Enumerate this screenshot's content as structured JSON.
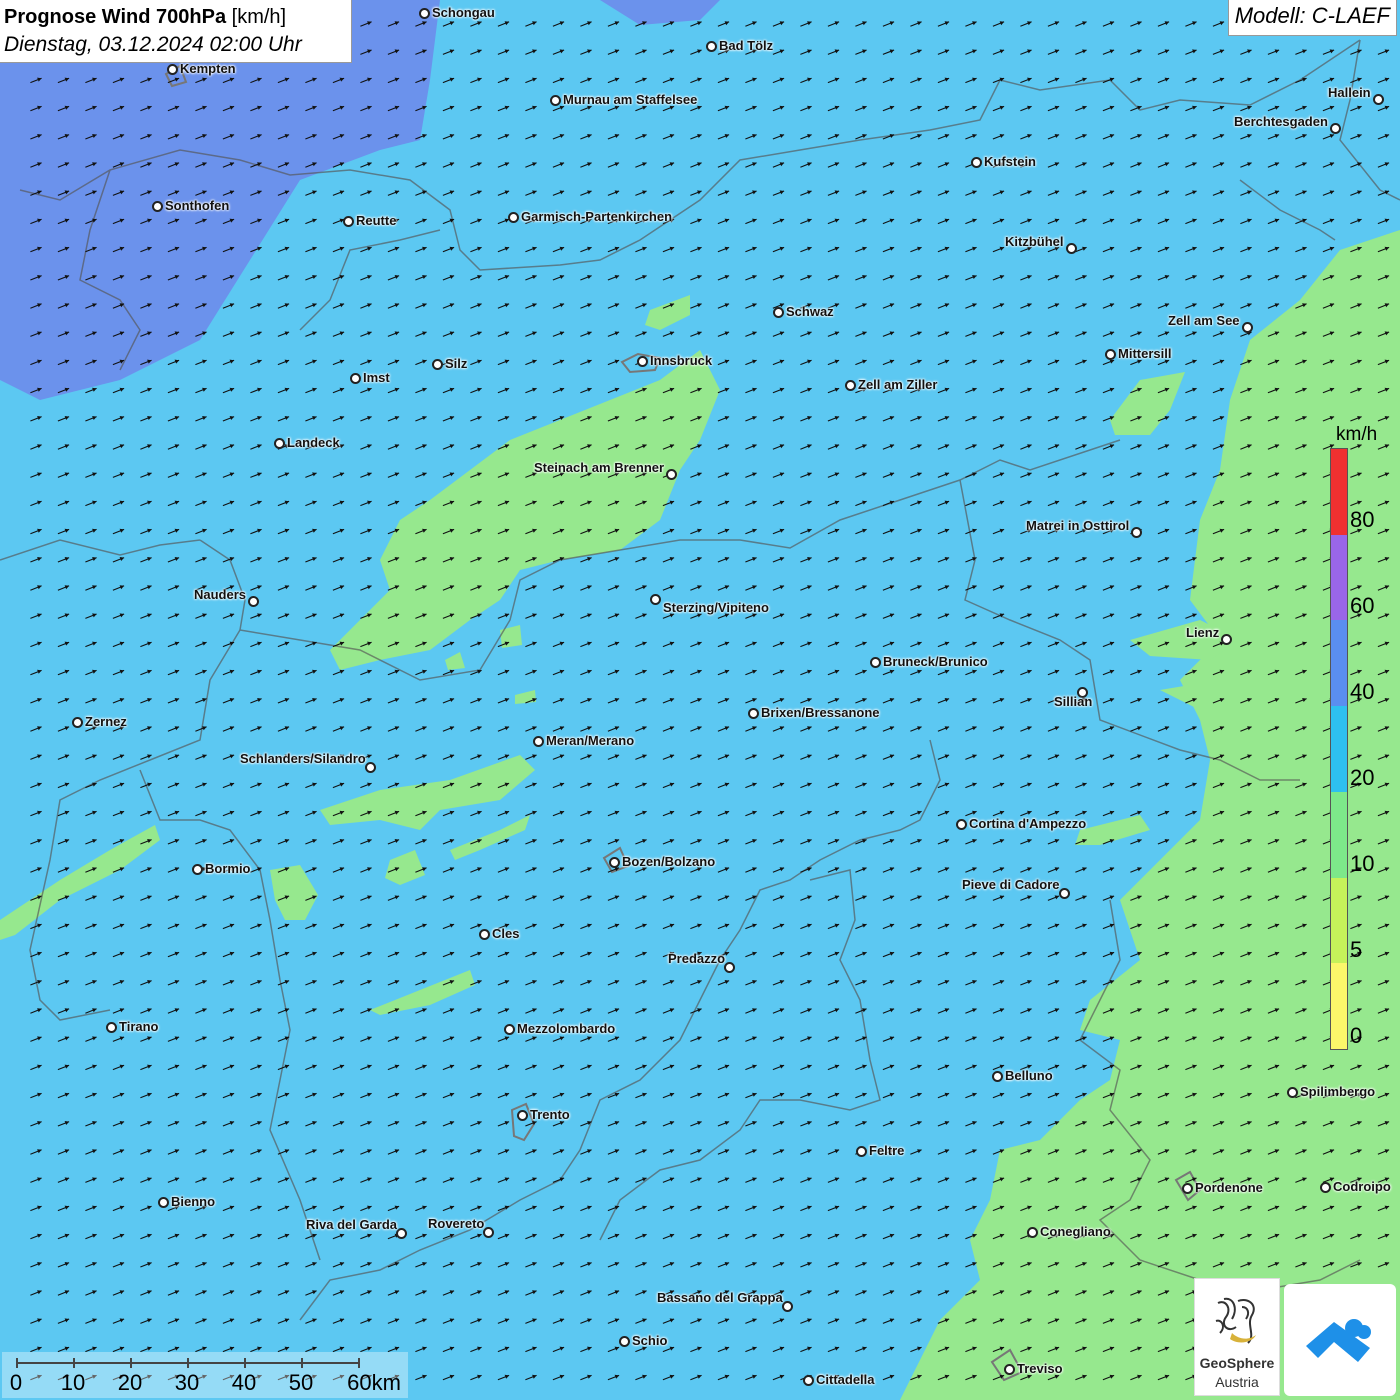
{
  "header": {
    "title_bold": "Prognose Wind 700hPa",
    "title_unit": "[km/h]",
    "datetime": "Dienstag, 03.12.2024 02:00 Uhr",
    "model": "Modell: C-LAEF"
  },
  "legend": {
    "unit": "km/h",
    "ticks": [
      "80",
      "60",
      "40",
      "20",
      "10",
      "5",
      "0"
    ],
    "colors": [
      "#f03030",
      "#9966e8",
      "#5a8ef0",
      "#2ec0ef",
      "#7de88a",
      "#c6f25a",
      "#fbf76a"
    ]
  },
  "scalebar": {
    "labels": [
      "0",
      "10",
      "20",
      "30",
      "40",
      "50",
      "60km"
    ]
  },
  "map": {
    "wind_direction": "west-southwest",
    "colors": {
      "band_40_60": "#6b92ec",
      "band_20_40": "#5cc8f2",
      "band_10_20": "#96e88e",
      "arrow": "#111111",
      "border": "#555555"
    },
    "cities": [
      {
        "name": "Schongau"
      },
      {
        "name": "Bad Tölz"
      },
      {
        "name": "Kempten"
      },
      {
        "name": "Murnau am Staffelsee"
      },
      {
        "name": "Hallein"
      },
      {
        "name": "Berchtesgaden"
      },
      {
        "name": "Kufstein"
      },
      {
        "name": "Sonthofen"
      },
      {
        "name": "Reutte"
      },
      {
        "name": "Garmisch-Partenkirchen"
      },
      {
        "name": "Kitzbühel"
      },
      {
        "name": "Schwaz"
      },
      {
        "name": "Zell am See"
      },
      {
        "name": "Mittersill"
      },
      {
        "name": "Innsbruck"
      },
      {
        "name": "Silz"
      },
      {
        "name": "Imst"
      },
      {
        "name": "Zell am Ziller"
      },
      {
        "name": "Landeck"
      },
      {
        "name": "Steinach am Brenner"
      },
      {
        "name": "Matrei in Osttirol"
      },
      {
        "name": "Nauders"
      },
      {
        "name": "Sterzing/Vipiteno"
      },
      {
        "name": "Lienz"
      },
      {
        "name": "Bruneck/Brunico"
      },
      {
        "name": "Sillian"
      },
      {
        "name": "Zernez"
      },
      {
        "name": "Brixen/Bressanone"
      },
      {
        "name": "Meran/Merano"
      },
      {
        "name": "Schlanders/Silandro"
      },
      {
        "name": "Cortina d'Ampezzo"
      },
      {
        "name": "Bozen/Bolzano"
      },
      {
        "name": "Bormio"
      },
      {
        "name": "Pieve di Cadore"
      },
      {
        "name": "Cles"
      },
      {
        "name": "Predazzo"
      },
      {
        "name": "Tirano"
      },
      {
        "name": "Mezzolombardo"
      },
      {
        "name": "Belluno"
      },
      {
        "name": "Spilimbergo"
      },
      {
        "name": "Trento"
      },
      {
        "name": "Feltre"
      },
      {
        "name": "Pordenone"
      },
      {
        "name": "Codroipo"
      },
      {
        "name": "Bienno"
      },
      {
        "name": "Riva del Garda"
      },
      {
        "name": "Rovereto"
      },
      {
        "name": "Conegliano"
      },
      {
        "name": "Bassano del Grappa"
      },
      {
        "name": "Schio"
      },
      {
        "name": "Treviso"
      },
      {
        "name": "Cittadella"
      }
    ]
  },
  "logos": {
    "geosphere_name": "GeoSphere",
    "geosphere_sub": "Austria"
  }
}
